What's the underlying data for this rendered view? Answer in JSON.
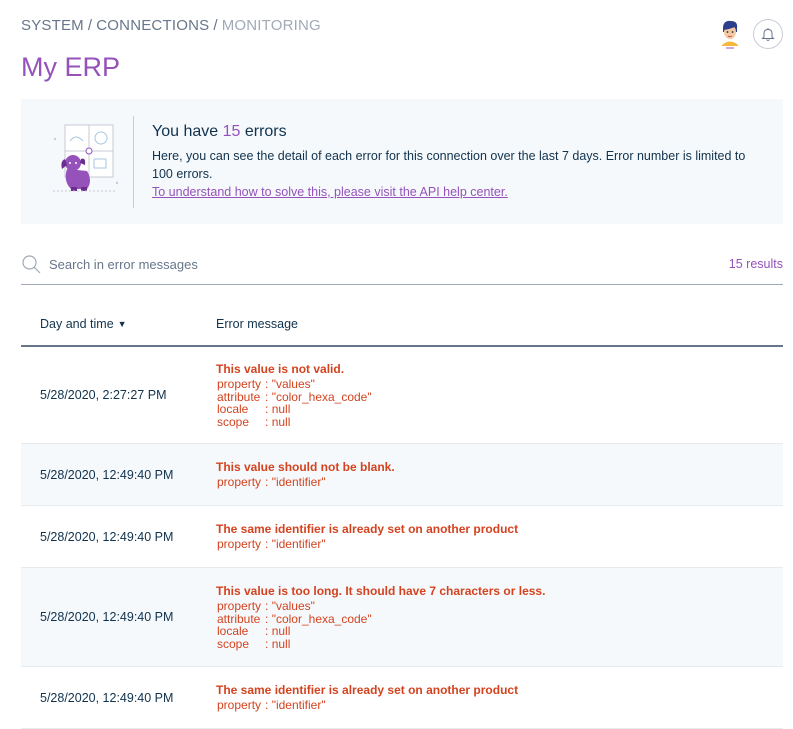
{
  "breadcrumb": {
    "items": [
      "SYSTEM",
      "CONNECTIONS"
    ],
    "current": "MONITORING"
  },
  "page": {
    "title": "My ERP"
  },
  "banner": {
    "prefix": "You have",
    "count": "15",
    "suffix": "errors",
    "description": "Here, you can see the detail of each error for this connection over the last 7 days. Error number is limited to 100 errors.",
    "help_link": "To understand how to solve this, please visit the API help center."
  },
  "search": {
    "placeholder": "Search in error messages",
    "value": "",
    "results": "15 results"
  },
  "table": {
    "headers": {
      "date": "Day and time",
      "message": "Error message"
    },
    "rows": [
      {
        "date": "5/28/2020, 2:27:27 PM",
        "message": "This value is not valid.",
        "props": [
          {
            "key": "property",
            "val": ": \"values\""
          },
          {
            "key": "attribute",
            "val": ": \"color_hexa_code\""
          },
          {
            "key": "locale",
            "val": ": null"
          },
          {
            "key": "scope",
            "val": ": null"
          }
        ]
      },
      {
        "date": "5/28/2020, 12:49:40 PM",
        "message": "This value should not be blank.",
        "props": [
          {
            "key": "property",
            "val": ": \"identifier\""
          }
        ]
      },
      {
        "date": "5/28/2020, 12:49:40 PM",
        "message": "The same identifier is already set on another product",
        "props": [
          {
            "key": "property",
            "val": ": \"identifier\""
          }
        ]
      },
      {
        "date": "5/28/2020, 12:49:40 PM",
        "message": "This value is too long. It should have 7 characters or less.",
        "props": [
          {
            "key": "property",
            "val": ": \"values\""
          },
          {
            "key": "attribute",
            "val": ": \"color_hexa_code\""
          },
          {
            "key": "locale",
            "val": ": null"
          },
          {
            "key": "scope",
            "val": ": null"
          }
        ]
      },
      {
        "date": "5/28/2020, 12:49:40 PM",
        "message": "The same identifier is already set on another product",
        "props": [
          {
            "key": "property",
            "val": ": \"identifier\""
          }
        ]
      }
    ]
  },
  "icons": {
    "search": "search-icon",
    "bell": "bell-icon",
    "avatar": "user-avatar",
    "sort": "caret-down-icon"
  },
  "colors": {
    "accent": "#9452ba",
    "error": "#d4431f",
    "text": "#11324d",
    "muted": "#67768a",
    "banner_bg": "#f5f9fc"
  }
}
